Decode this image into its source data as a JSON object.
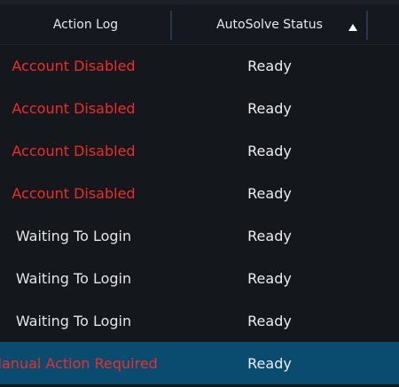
{
  "columns": {
    "action_log": "Action Log",
    "autosolve_status": "AutoSolve Status"
  },
  "sort": {
    "column": "autosolve_status",
    "direction": "ascending",
    "icon": "triangle-up-icon"
  },
  "colors": {
    "error_text": "#ef2b2b",
    "normal_text": "#e4e6e8",
    "selected_row": "#0a4c6f",
    "background": "#14171b"
  },
  "rows": [
    {
      "action": "Account Disabled",
      "status": "Ready",
      "level": "error"
    },
    {
      "action": "Account Disabled",
      "status": "Ready",
      "level": "error"
    },
    {
      "action": "Account Disabled",
      "status": "Ready",
      "level": "error"
    },
    {
      "action": "Account Disabled",
      "status": "Ready",
      "level": "error"
    },
    {
      "action": "Waiting To Login",
      "status": "Ready",
      "level": "normal"
    },
    {
      "action": "Waiting To Login",
      "status": "Ready",
      "level": "normal"
    },
    {
      "action": "Waiting To Login",
      "status": "Ready",
      "level": "normal"
    },
    {
      "action": "Manual Action Required",
      "status": "Ready",
      "level": "error",
      "selected": true
    }
  ]
}
